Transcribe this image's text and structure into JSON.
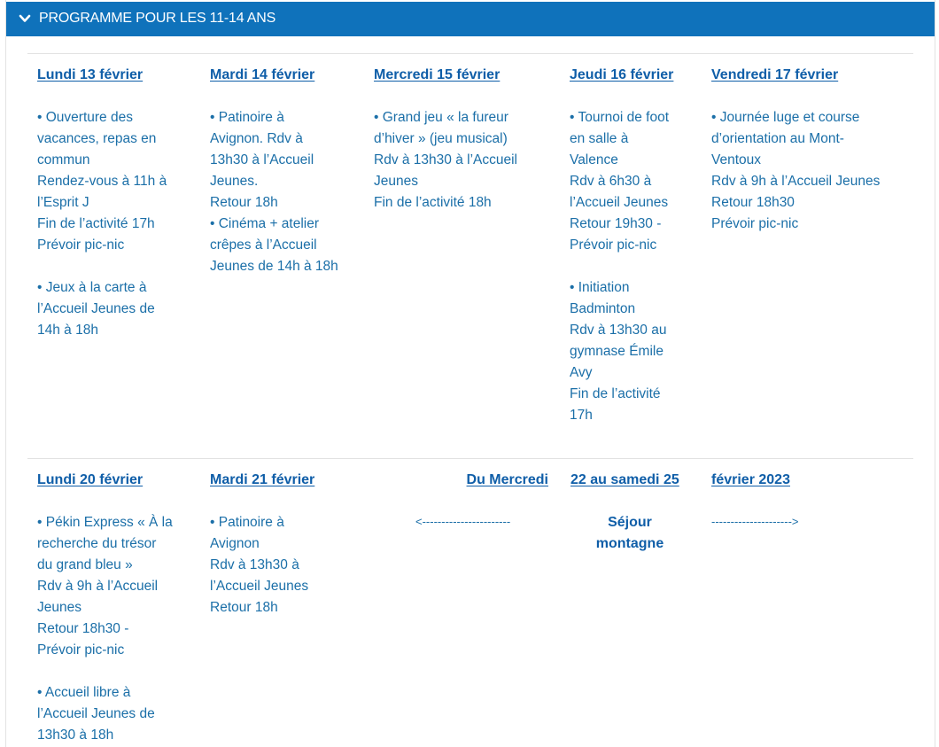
{
  "header": {
    "title": "PROGRAMME POUR LES 11-14 ANS"
  },
  "week1": [
    {
      "day": "Lundi 13 février",
      "lines": [
        "• Ouverture des",
        "vacances, repas en",
        "commun",
        "Rendez-vous à 11h à",
        "l’Esprit J",
        "Fin de l’activité 17h",
        "Prévoir pic-nic",
        "",
        "• Jeux à la carte à",
        "l’Accueil Jeunes de",
        "14h à 18h"
      ]
    },
    {
      "day": "Mardi 14 février",
      "lines": [
        "• Patinoire à",
        "Avignon. Rdv à",
        "13h30 à l’Accueil",
        "Jeunes.",
        "Retour 18h",
        "• Cinéma + atelier",
        "crêpes à l’Accueil",
        "Jeunes de 14h à 18h"
      ]
    },
    {
      "day": "Mercredi 15 février",
      "lines": [
        "• Grand jeu « la fureur",
        "d’hiver » (jeu musical)",
        "Rdv à 13h30 à l’Accueil",
        "Jeunes",
        "Fin de l’activité 18h"
      ]
    },
    {
      "day": "Jeudi 16 février",
      "lines": [
        "• Tournoi de foot",
        "en salle à",
        "Valence",
        "Rdv à 6h30 à",
        "l’Accueil Jeunes",
        "Retour 19h30 -",
        "Prévoir pic-nic",
        "",
        "• Initiation",
        "Badminton",
        "Rdv à 13h30 au",
        "gymnase Émile",
        "Avy",
        "Fin de l’activité",
        "17h"
      ]
    },
    {
      "day": "Vendredi 17 février",
      "lines": [
        "• Journée luge et course",
        "d’orientation au Mont-",
        "Ventoux",
        "Rdv à 9h à l’Accueil Jeunes",
        "Retour 18h30",
        "Prévoir pic-nic"
      ]
    }
  ],
  "week2": [
    {
      "day": "Lundi 20 février",
      "lines": [
        "• Pékin Express « À la",
        "recherche du trésor",
        "du grand bleu »",
        "Rdv à 9h à l’Accueil",
        "Jeunes",
        "Retour 18h30 -",
        "Prévoir pic-nic",
        "",
        "• Accueil libre à",
        "l’Accueil Jeunes de",
        "13h30 à 18h"
      ]
    },
    {
      "day": "Mardi 21 février",
      "lines": [
        "• Patinoire à",
        "Avignon",
        "Rdv à 13h30 à",
        "l’Accueil Jeunes",
        "Retour 18h"
      ]
    }
  ],
  "sejour": {
    "heading_part1": "Du Mercredi ",
    "heading_part2": "22 au samedi 25",
    "heading_part3": "février 2023",
    "arrow_left": "<-----------------------",
    "arrow_right": "--------------------->",
    "label_line1": "Séjour",
    "label_line2": "montagne"
  },
  "colors": {
    "header_bg": "#0f72bb",
    "text": "#1b6fa8",
    "heading": "#0f5ea8"
  }
}
